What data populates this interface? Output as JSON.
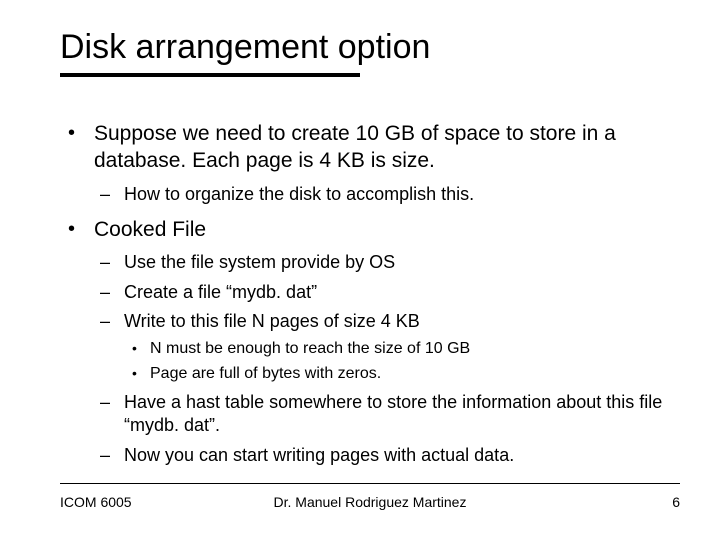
{
  "title": "Disk arrangement option",
  "bullets": {
    "b1": "Suppose we need to create 10 GB of space to store in a database. Each page is 4 KB is size.",
    "b1_1": "How to organize the disk to accomplish this.",
    "b2": "Cooked File",
    "b2_1": "Use the file system provide by OS",
    "b2_2": "Create a file “mydb. dat”",
    "b2_3": "Write to this file N pages of size 4 KB",
    "b2_3_1": "N must be enough to reach the size of 10 GB",
    "b2_3_2": "Page are full of bytes with zeros.",
    "b2_4": "Have a hast table somewhere to store the information about this file “mydb. dat”.",
    "b2_5": "Now you can start writing pages with actual data."
  },
  "footer": {
    "left": "ICOM 6005",
    "center": "Dr. Manuel Rodriguez Martinez",
    "right": "6"
  }
}
